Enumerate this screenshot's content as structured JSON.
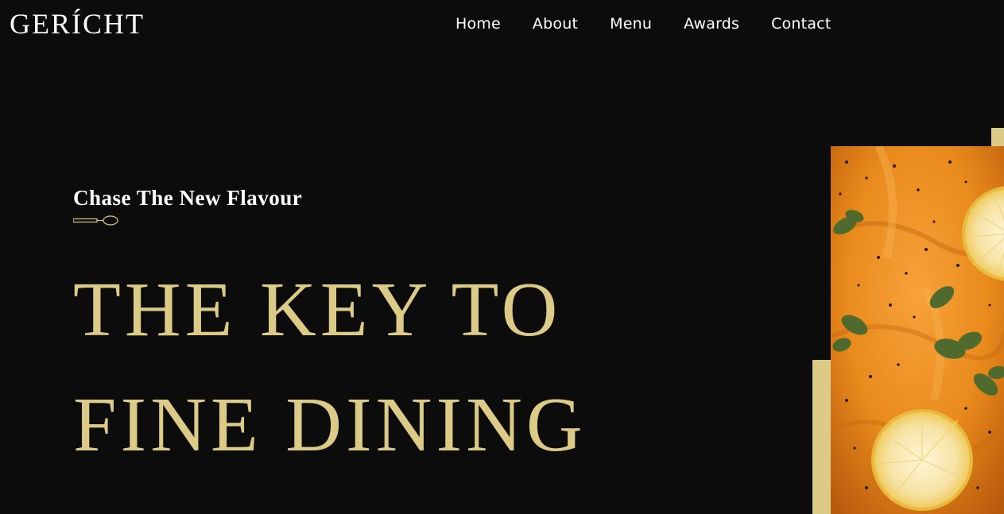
{
  "brand": {
    "logo": "GERÍCHT"
  },
  "nav": {
    "items": [
      "Home",
      "About",
      "Menu",
      "Awards",
      "Contact"
    ]
  },
  "hero": {
    "subtitle": "Chase The New Flavour",
    "headline_line1": "THE KEY TO",
    "headline_line2": "FINE DINING",
    "image_icon": "salmon-dish-image"
  },
  "colors": {
    "background": "#0c0c0c",
    "accent_gold": "#dcca87",
    "text_white": "#ffffff"
  }
}
